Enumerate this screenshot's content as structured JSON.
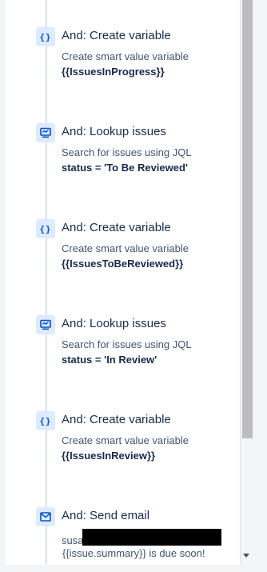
{
  "steps": [
    {
      "icon": "braces-icon",
      "title": "And: Create variable",
      "desc": "Create smart value variable",
      "detail": "{{IssuesInProgress}}"
    },
    {
      "icon": "lookup-icon",
      "title": "And: Lookup issues",
      "desc": "Search for issues using JQL",
      "detail": "status = 'To Be Reviewed'"
    },
    {
      "icon": "braces-icon",
      "title": "And: Create variable",
      "desc": "Create smart value variable",
      "detail": "{{IssuesToBeReviewed}}"
    },
    {
      "icon": "lookup-icon",
      "title": "And: Lookup issues",
      "desc": "Search for issues using JQL",
      "detail": "status = 'In Review'"
    },
    {
      "icon": "braces-icon",
      "title": "And: Create variable",
      "desc": "Create smart value variable",
      "detail": "{{IssuesInReview}}"
    },
    {
      "icon": "email-icon",
      "title": "And: Send email",
      "desc": "susa",
      "detail": "{{issue.summary}} is due soon!"
    }
  ],
  "colors": {
    "accent": "#0052cc",
    "icon_bg": "#deebff"
  }
}
